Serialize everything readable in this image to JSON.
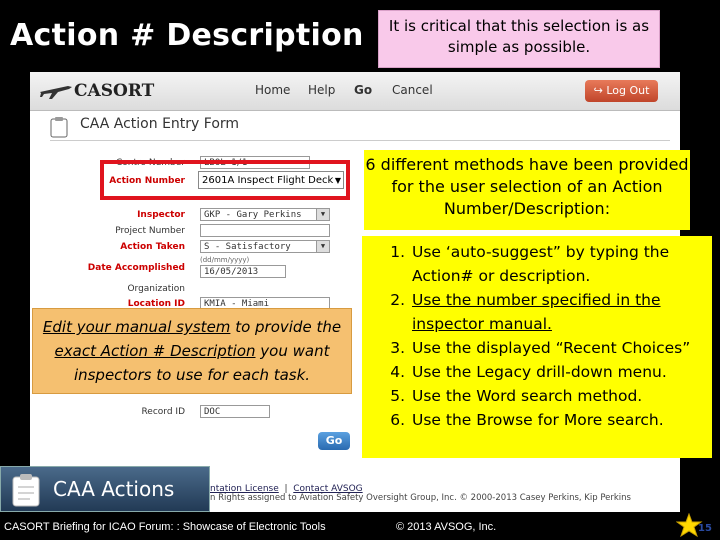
{
  "slide": {
    "title": "Action # Description",
    "pink_callout": "It is critical that this selection is as  simple as possible.",
    "footer_left": "CASORT Briefing for ICAO Forum: : Showcase of Electronic Tools",
    "footer_center": "© 2013 AVSOG, Inc.",
    "page_number": "15"
  },
  "app": {
    "logo_text": "CASORT",
    "nav": [
      "Home",
      "Help",
      "Go",
      "Cancel"
    ],
    "logout_label": "Log Out",
    "form_title": "CAA Action Entry Form",
    "fields": {
      "control_number_label": "Contro Number",
      "control_number_value": "LBOL 1/1",
      "action_number_label": "Action Number",
      "action_number_value": "2601A   Inspect Flight Deck",
      "inspector_label": "Inspector",
      "inspector_value": "GKP - Gary Perkins",
      "project_number_label": "Project Number",
      "action_taken_label": "Action Taken",
      "action_taken_value": "S - Satisfactory",
      "date_label": "Date Accomplished",
      "date_hint": "(dd/mm/yyyy)",
      "date_value": "16/05/2013",
      "organization_label": "Organization",
      "location_label": "Location ID",
      "location_value": "KMIA - Miami International",
      "record_id_label": "Record ID",
      "record_id_value": "DOC"
    },
    "go_button": "Go",
    "footer_links": [
      "ntation License",
      "Contact AVSOG"
    ],
    "footer_copyright": "n Rights assigned to Aviation Safety Oversight Group, Inc.   © 2000-2013 Casey Perkins, Kip Perkins"
  },
  "callouts": {
    "methods_title": "6 different methods have been provided for the user selection of an Action Number/Description:",
    "methods": [
      "Use ‘auto-suggest” by typing the Action# or description.",
      "Use the number specified in the inspector manual.",
      "Use the  displayed “Recent Choices”",
      "Use the Legacy drill-down menu.",
      "Use the Word search method.",
      "Use the Browse for More search."
    ],
    "manual_note_part1": "Edit your manual system",
    "manual_note_part2": " to provide the ",
    "manual_note_part3": "exact Action # Description",
    "manual_note_part4": " you want inspectors to use for each task."
  },
  "badge": {
    "label": "CAA Actions"
  },
  "colors": {
    "highlight_yellow": "#ffff00",
    "callout_pink": "#f9c9ea",
    "callout_orange": "#f5c070",
    "red_box": "#e0141e"
  }
}
